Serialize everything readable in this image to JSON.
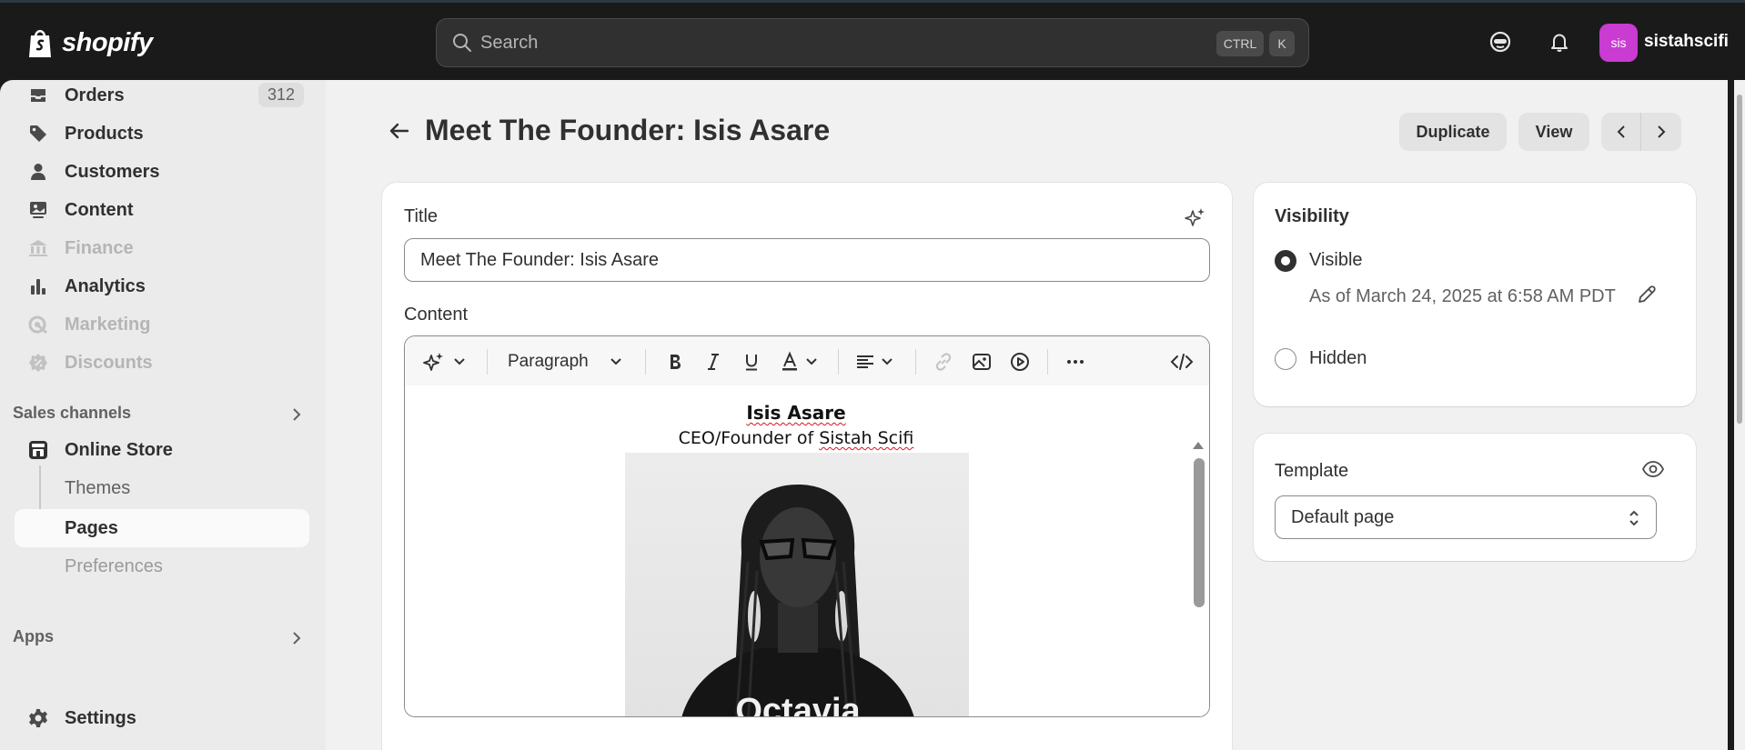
{
  "brand": {
    "name": "shopify"
  },
  "search": {
    "placeholder": "Search",
    "shortcut_ctrl": "CTRL",
    "shortcut_key": "K"
  },
  "user": {
    "initials": "sis",
    "name": "sistahscifi"
  },
  "sidebar": {
    "items": [
      {
        "label": "Orders",
        "icon": "inbox-icon",
        "badge": "312"
      },
      {
        "label": "Products",
        "icon": "tag-icon"
      },
      {
        "label": "Customers",
        "icon": "person-icon"
      },
      {
        "label": "Content",
        "icon": "image-icon"
      },
      {
        "label": "Finance",
        "icon": "bank-icon",
        "disabled": true
      },
      {
        "label": "Analytics",
        "icon": "bar-chart-icon"
      },
      {
        "label": "Marketing",
        "icon": "target-icon",
        "disabled": true
      },
      {
        "label": "Discounts",
        "icon": "discount-icon",
        "disabled": true
      }
    ],
    "sales_channels_label": "Sales channels",
    "online_store": {
      "label": "Online Store",
      "subitems": [
        {
          "label": "Themes"
        },
        {
          "label": "Pages",
          "active": true
        },
        {
          "label": "Preferences"
        }
      ]
    },
    "apps_label": "Apps",
    "settings_label": "Settings"
  },
  "page": {
    "title": "Meet The Founder: Isis Asare",
    "buttons": {
      "duplicate": "Duplicate",
      "view": "View"
    }
  },
  "form": {
    "title_label": "Title",
    "title_value": "Meet The Founder: Isis Asare",
    "content_label": "Content",
    "toolbar": {
      "paragraph": "Paragraph"
    },
    "document": {
      "name": "Isis Asare",
      "role_prefix": "CEO/Founder of ",
      "role_company": "Sistah Scifi",
      "photo_shirt_text": "Octavia"
    }
  },
  "visibility": {
    "heading": "Visibility",
    "visible_label": "Visible",
    "visible_date": "As of March 24, 2025 at 6:58 AM PDT",
    "hidden_label": "Hidden",
    "selected": "visible"
  },
  "template": {
    "label": "Template",
    "value": "Default page"
  },
  "colors": {
    "accent": "#c93bd1",
    "topbar": "#1a1a1a",
    "background": "#f1f1f1"
  }
}
